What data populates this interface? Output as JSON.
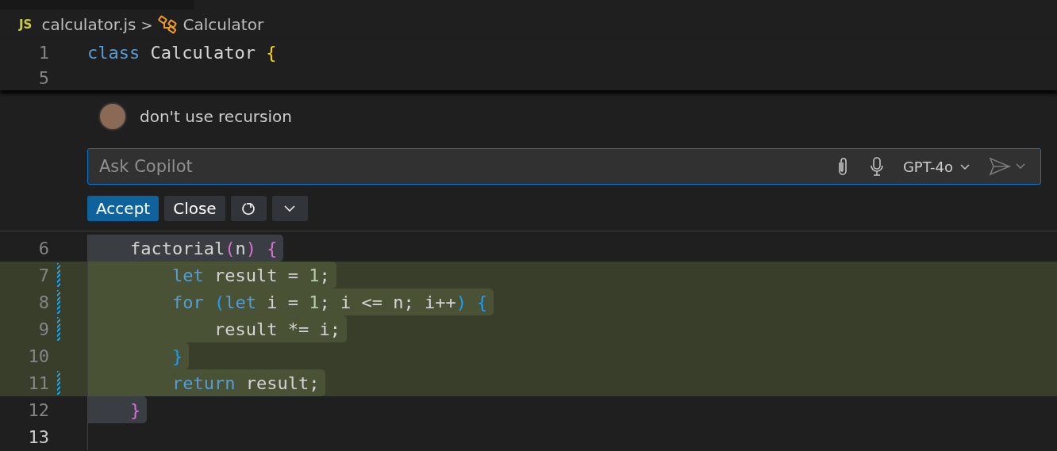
{
  "breadcrumb": {
    "file_badge": "JS",
    "file": "calculator.js",
    "separator": ">",
    "symbol": "Calculator"
  },
  "sticky_lines": [
    {
      "number": "1",
      "tokens": [
        {
          "text": "class",
          "kind": "keyword"
        },
        {
          "text": " Calculator ",
          "kind": "plain"
        },
        {
          "text": "{",
          "kind": "bracket1"
        }
      ]
    },
    {
      "number": "5"
    }
  ],
  "chat": {
    "message": "don't use recursion",
    "input": {
      "placeholder": "Ask Copilot"
    },
    "model": "GPT-4o",
    "buttons": [
      {
        "label": "Accept",
        "kind": "primary"
      },
      {
        "label": "Close",
        "kind": "secondary"
      },
      {
        "kind": "rerun"
      },
      {
        "kind": "more"
      }
    ]
  },
  "code_lines": [
    {
      "number": "6",
      "kind": "selected",
      "changed": false,
      "current": false,
      "tokens": [
        {
          "text": "    factorial",
          "kind": "plain"
        },
        {
          "text": "(",
          "kind": "bracket2"
        },
        {
          "text": "n",
          "kind": "plain"
        },
        {
          "text": ") {",
          "kind": "bracket2"
        }
      ]
    },
    {
      "number": "7",
      "kind": "inserted",
      "changed": true,
      "current": false,
      "tokens": [
        {
          "text": "        let",
          "kind": "keyword"
        },
        {
          "text": " result = ",
          "kind": "plain"
        },
        {
          "text": "1",
          "kind": "number"
        },
        {
          "text": ";",
          "kind": "plain"
        }
      ]
    },
    {
      "number": "8",
      "kind": "inserted",
      "changed": true,
      "current": false,
      "tokens": [
        {
          "text": "        for",
          "kind": "keyword"
        },
        {
          "text": " (",
          "kind": "bracket3"
        },
        {
          "text": "let",
          "kind": "keyword"
        },
        {
          "text": " i = ",
          "kind": "plain"
        },
        {
          "text": "1",
          "kind": "number"
        },
        {
          "text": "; i <= n; i++",
          "kind": "plain"
        },
        {
          "text": ") {",
          "kind": "bracket3"
        }
      ]
    },
    {
      "number": "9",
      "kind": "inserted",
      "changed": true,
      "current": false,
      "tokens": [
        {
          "text": "            result *= i;",
          "kind": "plain"
        }
      ]
    },
    {
      "number": "10",
      "kind": "inserted",
      "changed": false,
      "current": false,
      "tokens": [
        {
          "text": "        }",
          "kind": "bracket3"
        }
      ]
    },
    {
      "number": "11",
      "kind": "inserted",
      "changed": true,
      "current": false,
      "tokens": [
        {
          "text": "        return",
          "kind": "keyword"
        },
        {
          "text": " result;",
          "kind": "plain"
        }
      ]
    },
    {
      "number": "12",
      "kind": "selected",
      "changed": false,
      "current": false,
      "tokens": [
        {
          "text": "    }",
          "kind": "bracket2"
        }
      ]
    },
    {
      "number": "13",
      "kind": "plain",
      "changed": false,
      "current": true
    }
  ]
}
